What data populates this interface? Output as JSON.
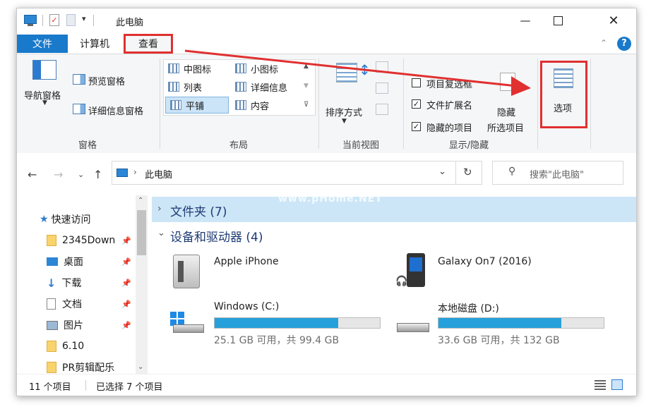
{
  "window": {
    "title": "此电脑"
  },
  "tabs": {
    "file": "文件",
    "computer": "计算机",
    "view": "查看"
  },
  "ribbon": {
    "pane": {
      "nav_pane": "导航窗格",
      "preview": "预览窗格",
      "details": "详细信息窗格",
      "group": "窗格"
    },
    "layout": {
      "items": [
        "中图标",
        "小图标",
        "列表",
        "详细信息",
        "平铺",
        "内容"
      ],
      "group": "布局"
    },
    "current_view": {
      "sort": "排序方式",
      "group": "当前视图"
    },
    "show_hide": {
      "item_checkbox": "项目复选框",
      "file_ext": "文件扩展名",
      "hidden_items": "隐藏的项目",
      "hide_selected_1": "隐藏",
      "hide_selected_2": "所选项目",
      "group": "显示/隐藏"
    },
    "options": "选项"
  },
  "address": {
    "path": "此电脑",
    "search_placeholder": "搜索\"此电脑\""
  },
  "nav": {
    "quick_access": "快速访问",
    "items": [
      "2345Down",
      "桌面",
      "下载",
      "文档",
      "图片",
      "6.10",
      "PR剪辑配乐"
    ]
  },
  "content": {
    "folders_group": "文件夹 (7)",
    "devices_group": "设备和驱动器 (4)",
    "devices": [
      {
        "name": "Apple iPhone"
      },
      {
        "name": "Galaxy On7 (2016)"
      },
      {
        "name": "Windows (C:)",
        "info": "25.1 GB 可用，共 99.4 GB",
        "used_fraction": 0.747
      },
      {
        "name": "本地磁盘 (D:)",
        "info": "33.6 GB 可用，共 132 GB",
        "used_fraction": 0.745
      }
    ]
  },
  "status": {
    "count": "11 个项目",
    "selected": "已选择 7 个项目"
  },
  "watermark": "www.pHome.NET",
  "colors": {
    "accent": "#1979ca",
    "highlight": "#e03030",
    "bar_fill": "#26a0da"
  }
}
